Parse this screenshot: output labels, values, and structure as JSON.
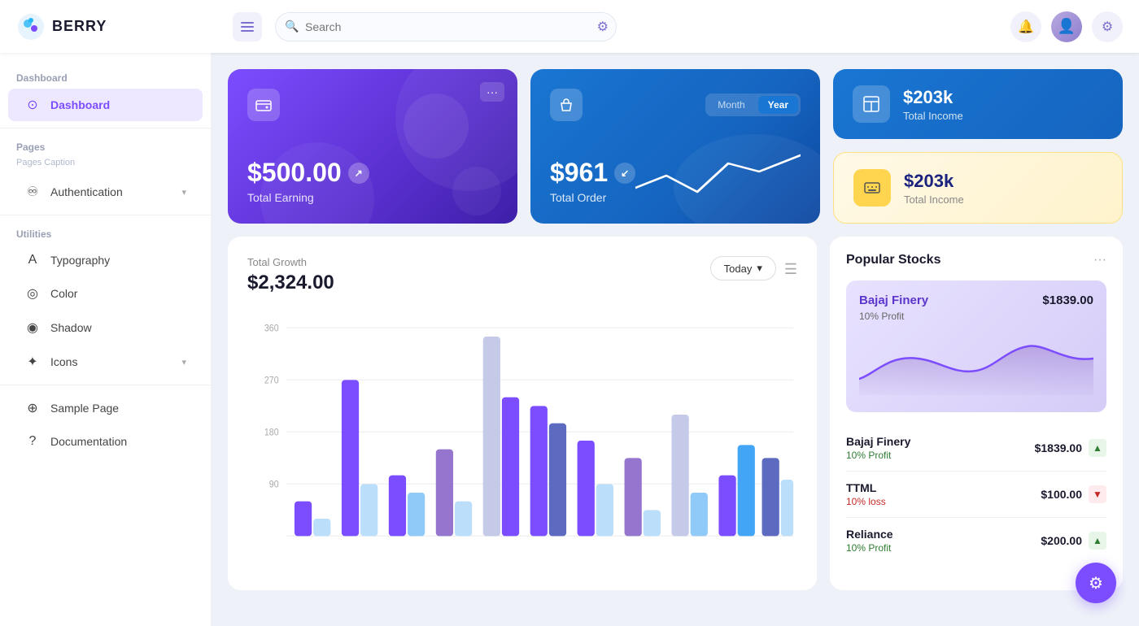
{
  "header": {
    "logo_text": "BERRY",
    "search_placeholder": "Search",
    "hamburger_label": "☰"
  },
  "sidebar": {
    "section1": "Dashboard",
    "dashboard_item": "Dashboard",
    "section2": "Pages",
    "section2_caption": "Pages Caption",
    "auth_item": "Authentication",
    "section3": "Utilities",
    "typography_item": "Typography",
    "color_item": "Color",
    "shadow_item": "Shadow",
    "icons_item": "Icons",
    "sample_page_item": "Sample Page",
    "documentation_item": "Documentation"
  },
  "cards": {
    "earning_amount": "$500.00",
    "earning_label": "Total Earning",
    "order_amount": "$961",
    "order_label": "Total Order",
    "order_tab_month": "Month",
    "order_tab_year": "Year",
    "income_blue_amount": "$203k",
    "income_blue_label": "Total Income",
    "income_yellow_amount": "$203k",
    "income_yellow_label": "Total Income"
  },
  "growth_chart": {
    "title": "Total Growth",
    "amount": "$2,324.00",
    "filter_btn": "Today",
    "y_labels": [
      "360",
      "270",
      "180",
      "90",
      ""
    ]
  },
  "stocks": {
    "title": "Popular Stocks",
    "featured_name": "Bajaj Finery",
    "featured_price": "$1839.00",
    "featured_profit": "10% Profit",
    "rows": [
      {
        "name": "Bajaj Finery",
        "price": "$1839.00",
        "profit": "10% Profit",
        "direction": "up"
      },
      {
        "name": "TTML",
        "price": "$100.00",
        "profit": "10% loss",
        "direction": "down"
      },
      {
        "name": "Reliance",
        "price": "$200.00",
        "profit": "10% Profit",
        "direction": "up"
      }
    ]
  }
}
